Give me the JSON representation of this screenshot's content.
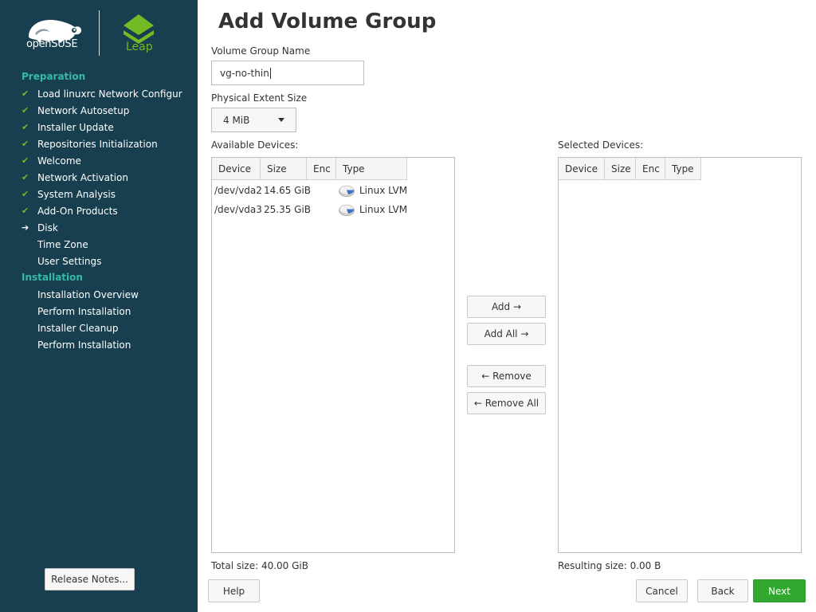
{
  "branding": {
    "opensuse": "openSUSE",
    "leap": "Leap"
  },
  "sidebar": {
    "sections": [
      {
        "title": "Preparation"
      },
      {
        "title": "Installation"
      }
    ],
    "steps": [
      {
        "label": "Load linuxrc Network Configur",
        "status": "done"
      },
      {
        "label": "Network Autosetup",
        "status": "done"
      },
      {
        "label": "Installer Update",
        "status": "done"
      },
      {
        "label": "Repositories Initialization",
        "status": "done"
      },
      {
        "label": "Welcome",
        "status": "done"
      },
      {
        "label": "Network Activation",
        "status": "done"
      },
      {
        "label": "System Analysis",
        "status": "done"
      },
      {
        "label": "Add-On Products",
        "status": "done"
      },
      {
        "label": "Disk",
        "status": "current"
      },
      {
        "label": "Time Zone",
        "status": "pending"
      },
      {
        "label": "User Settings",
        "status": "pending"
      },
      {
        "label": "Installation Overview",
        "status": "pending"
      },
      {
        "label": "Perform Installation",
        "status": "pending"
      },
      {
        "label": "Installer Cleanup",
        "status": "pending"
      },
      {
        "label": "Perform Installation",
        "status": "pending"
      }
    ],
    "release_notes": "Release Notes..."
  },
  "main": {
    "title": "Add Volume Group",
    "vg_name": {
      "label": "Volume Group Name",
      "value": "vg-no-thin"
    },
    "pe_size": {
      "label": "Physical Extent Size",
      "value": "4 MiB"
    },
    "available": {
      "label": "Available Devices:",
      "columns": [
        "Device",
        "Size",
        "Enc",
        "Type"
      ],
      "rows": [
        {
          "device": "/dev/vda2",
          "size": "14.65 GiB",
          "enc": "",
          "type": "Linux LVM"
        },
        {
          "device": "/dev/vda3",
          "size": "25.35 GiB",
          "enc": "",
          "type": "Linux LVM"
        }
      ],
      "total": "Total size: 40.00 GiB"
    },
    "selected": {
      "label": "Selected Devices:",
      "columns": [
        "Device",
        "Size",
        "Enc",
        "Type"
      ],
      "rows": [],
      "total": "Resulting size: 0.00 B"
    },
    "buttons": {
      "add": "Add →",
      "add_all": "Add All →",
      "remove": "← Remove",
      "remove_all": "← Remove All"
    }
  },
  "footer": {
    "help": "Help",
    "cancel": "Cancel",
    "back": "Back",
    "next": "Next"
  },
  "colors": {
    "sidebar_bg": "#173f4f",
    "section_title": "#35b9ab",
    "check": "#73ba25",
    "next_button": "#30a82e"
  },
  "icons": {
    "done": "check-icon",
    "current": "arrow-right-icon",
    "disk": "disk-icon"
  }
}
